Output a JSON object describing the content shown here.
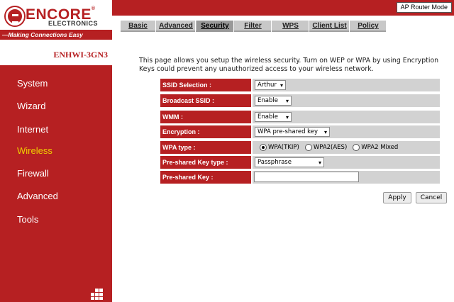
{
  "brand": {
    "logo_text": "ENCORE",
    "logo_reg": "®",
    "logo_sub": "ELECTRONICS",
    "tagline": "—Making Connections Easy",
    "model": "ENHWI-3GN3"
  },
  "mode_badge": "AP Router Mode",
  "nav": {
    "items": [
      {
        "label": "System"
      },
      {
        "label": "Wizard"
      },
      {
        "label": "Internet"
      },
      {
        "label": "Wireless"
      },
      {
        "label": "Firewall"
      },
      {
        "label": "Advanced"
      },
      {
        "label": "Tools"
      }
    ],
    "active": "Wireless"
  },
  "tabs": [
    {
      "label": "Basic"
    },
    {
      "label": "Advanced"
    },
    {
      "label": "Security"
    },
    {
      "label": "Filter"
    },
    {
      "label": "WPS"
    },
    {
      "label": "Client List"
    },
    {
      "label": "Policy"
    }
  ],
  "active_tab": "Security",
  "intro": "This page allows you setup the wireless security. Turn on WEP or WPA by using Encryption Keys could prevent any unauthorized access to your wireless network.",
  "form": {
    "ssid_selection": {
      "label": "SSID Selection :",
      "value": "Arthur"
    },
    "broadcast_ssid": {
      "label": "Broadcast SSID :",
      "value": "Enable"
    },
    "wmm": {
      "label": "WMM :",
      "value": "Enable"
    },
    "encryption": {
      "label": "Encryption :",
      "value": "WPA pre-shared key"
    },
    "wpa_type": {
      "label": "WPA type :",
      "options": [
        "WPA(TKIP)",
        "WPA2(AES)",
        "WPA2 Mixed"
      ],
      "selected": "WPA(TKIP)"
    },
    "psk_type": {
      "label": "Pre-shared Key type :",
      "value": "Passphrase"
    },
    "psk": {
      "label": "Pre-shared Key :",
      "value": ""
    }
  },
  "buttons": {
    "apply": "Apply",
    "cancel": "Cancel"
  },
  "colors": {
    "brand_red": "#b62022",
    "active_nav": "#f0d000",
    "tab_bg": "#c8c8c8",
    "tab_active": "#999999",
    "value_cell": "#d2d2d2"
  },
  "icons": {
    "dropdown": "▾",
    "grid": "grid-icon"
  }
}
